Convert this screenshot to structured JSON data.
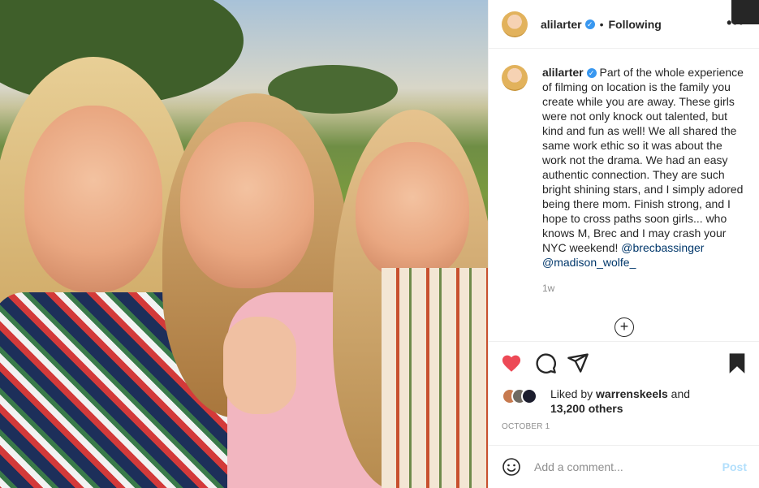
{
  "header": {
    "username": "alilarter",
    "separator": "•",
    "follow_status": "Following",
    "more": "•••"
  },
  "caption": {
    "username": "alilarter",
    "text": "Part of the whole experience of filming on location is the family you create while you are away. These girls were not only knock out talented, but kind and fun as well! We all shared the same work ethic so it was about the work not the drama. We had an easy authentic connection. They are such bright shining stars, and I simply adored being there mom. Finish strong, and I hope to cross paths soon girls... who knows M, Brec and I may crash your NYC weekend! ",
    "mention1": "@brecbassinger",
    "mention2": "@madison_wolfe_",
    "age": "1w"
  },
  "load_more": "+",
  "icons": {
    "verified": "verified-badge-icon",
    "like": "heart-icon",
    "comment": "comment-icon",
    "share": "share-icon",
    "save": "bookmark-icon",
    "emoji": "smile-icon",
    "load_more": "plus-circle-icon"
  },
  "colors": {
    "like_red": "#ed4956",
    "link": "#00376b",
    "verified_blue": "#3897f0",
    "post_disabled": "#b2dffc"
  },
  "likes": {
    "prefix": "Liked by ",
    "user": "warrenskeels",
    "and": " and",
    "others": "13,200 others"
  },
  "date": "OCTOBER 1",
  "comment_box": {
    "placeholder": "Add a comment...",
    "post_label": "Post"
  }
}
